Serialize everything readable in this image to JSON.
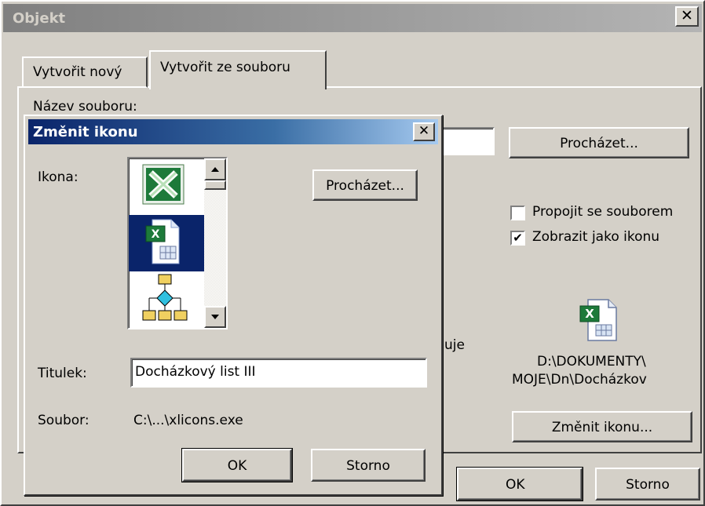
{
  "outer_dialog": {
    "title": "Objekt",
    "close_glyph": "✕",
    "tabs": [
      {
        "label": "Vytvořit nový",
        "active": false
      },
      {
        "label": "Vytvořit ze souboru",
        "active": true
      }
    ],
    "file_name_label": "Název souboru:",
    "browse_button": "Procházet...",
    "link_checkbox": {
      "label": "Propojit se souborem",
      "checked": false
    },
    "display_as_icon_checkbox": {
      "label": "Zobrazit jako ikonu",
      "checked": true,
      "check_glyph": "✔"
    },
    "obscured_text_fragment": "uje",
    "icon_caption_line1": "D:\\DOKUMENTY\\",
    "icon_caption_line2": "MOJE\\Dn\\Docházkov",
    "change_icon_button": "Změnit ikonu...",
    "ok_button": "OK",
    "cancel_button": "Storno"
  },
  "inner_dialog": {
    "title": "Změnit ikonu",
    "close_glyph": "✕",
    "icon_label": "Ikona:",
    "browse_button": "Procházet...",
    "icons": [
      {
        "name": "excel-app-icon",
        "selected": false
      },
      {
        "name": "excel-document-icon",
        "selected": true
      },
      {
        "name": "flowchart-icon",
        "selected": false
      }
    ],
    "caption_label": "Titulek:",
    "caption_value": "Docházkový list III",
    "file_label": "Soubor:",
    "file_value": "C:\\...\\xlicons.exe",
    "ok_button": "OK",
    "cancel_button": "Storno"
  },
  "colors": {
    "dialog_face": "#d4d0c8",
    "active_title_start": "#0a246a",
    "active_title_end": "#a6caf0",
    "inactive_title": "#808080",
    "excel_green": "#1d7a3a"
  }
}
